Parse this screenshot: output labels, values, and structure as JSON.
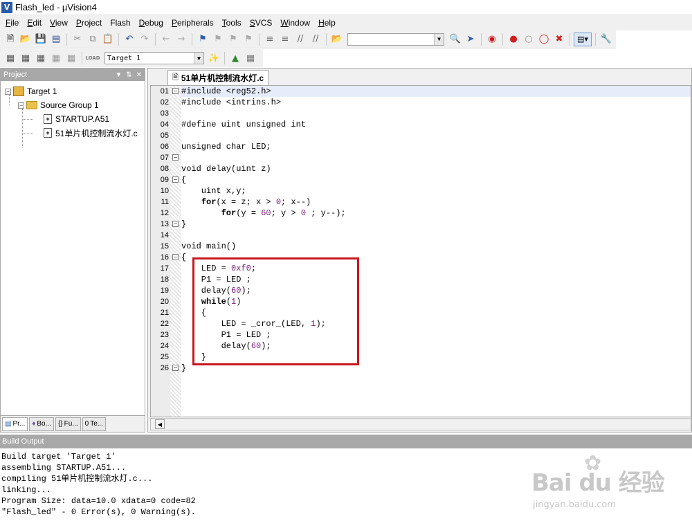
{
  "window": {
    "title": "Flash_led  - µVision4"
  },
  "menu": [
    {
      "label": "File",
      "underline": "F",
      "rest": "ile"
    },
    {
      "label": "Edit",
      "underline": "E",
      "rest": "dit"
    },
    {
      "label": "View",
      "underline": "V",
      "rest": "iew"
    },
    {
      "label": "Project",
      "underline": "P",
      "rest": "roject"
    },
    {
      "label": "Flash",
      "underline": "",
      "rest": "Flash"
    },
    {
      "label": "Debug",
      "underline": "D",
      "rest": "ebug"
    },
    {
      "label": "Peripherals",
      "underline": "P",
      "rest": "eripherals"
    },
    {
      "label": "Tools",
      "underline": "T",
      "rest": "ools"
    },
    {
      "label": "SVCS",
      "underline": "S",
      "rest": "VCS"
    },
    {
      "label": "Window",
      "underline": "W",
      "rest": "indow"
    },
    {
      "label": "Help",
      "underline": "H",
      "rest": "elp"
    }
  ],
  "toolbar": {
    "target_combo": "Target 1",
    "load_label": "LOAD"
  },
  "project_panel": {
    "title": "Project",
    "tree": {
      "target": "Target 1",
      "group": "Source Group 1",
      "files": [
        "STARTUP.A51",
        "51单片机控制流水灯.c"
      ]
    },
    "tabs": [
      "Pr...",
      "Bo...",
      "Fu...",
      "Te..."
    ]
  },
  "editor": {
    "tab_label": "51单片机控制流水灯.c",
    "lines": [
      {
        "n": "01",
        "text": "#include <reg52.h>"
      },
      {
        "n": "02",
        "text": "#include <intrins.h>"
      },
      {
        "n": "03",
        "text": ""
      },
      {
        "n": "04",
        "text": "#define uint unsigned int"
      },
      {
        "n": "05",
        "text": ""
      },
      {
        "n": "06",
        "text": "unsigned char LED;"
      },
      {
        "n": "07",
        "text": ""
      },
      {
        "n": "08",
        "text": "void delay(uint z)"
      },
      {
        "n": "09",
        "text": "{"
      },
      {
        "n": "10",
        "text": "    uint x,y;"
      },
      {
        "n": "11",
        "text": "    for(x = z; x > 0; x--)"
      },
      {
        "n": "12",
        "text": "        for(y = 60; y > 0 ; y--);"
      },
      {
        "n": "13",
        "text": "}"
      },
      {
        "n": "14",
        "text": ""
      },
      {
        "n": "15",
        "text": "void main()"
      },
      {
        "n": "16",
        "text": "{"
      },
      {
        "n": "17",
        "text": "    LED = 0xf0;"
      },
      {
        "n": "18",
        "text": "    P1 = LED ;"
      },
      {
        "n": "19",
        "text": "    delay(60);"
      },
      {
        "n": "20",
        "text": "    while(1)"
      },
      {
        "n": "21",
        "text": "    {"
      },
      {
        "n": "22",
        "text": "        LED = _cror_(LED, 1);"
      },
      {
        "n": "23",
        "text": "        P1 = LED ;"
      },
      {
        "n": "24",
        "text": "        delay(60);"
      },
      {
        "n": "25",
        "text": "    }"
      },
      {
        "n": "26",
        "text": "}"
      }
    ]
  },
  "build_output": {
    "title": "Build Output",
    "lines": [
      "Build target 'Target 1'",
      "assembling STARTUP.A51...",
      "compiling 51单片机控制流水灯.c...",
      "linking...",
      "Program Size: data=10.0 xdata=0 code=82",
      "\"Flash_led\" - 0 Error(s), 0 Warning(s)."
    ]
  },
  "watermark": {
    "logo": "Bai du 经验",
    "url": "jingyan.baidu.com"
  },
  "colors": {
    "panel_header": "#a8a8a8",
    "highlight_box": "#c8161d",
    "number_literal": "#7a1e7a"
  }
}
